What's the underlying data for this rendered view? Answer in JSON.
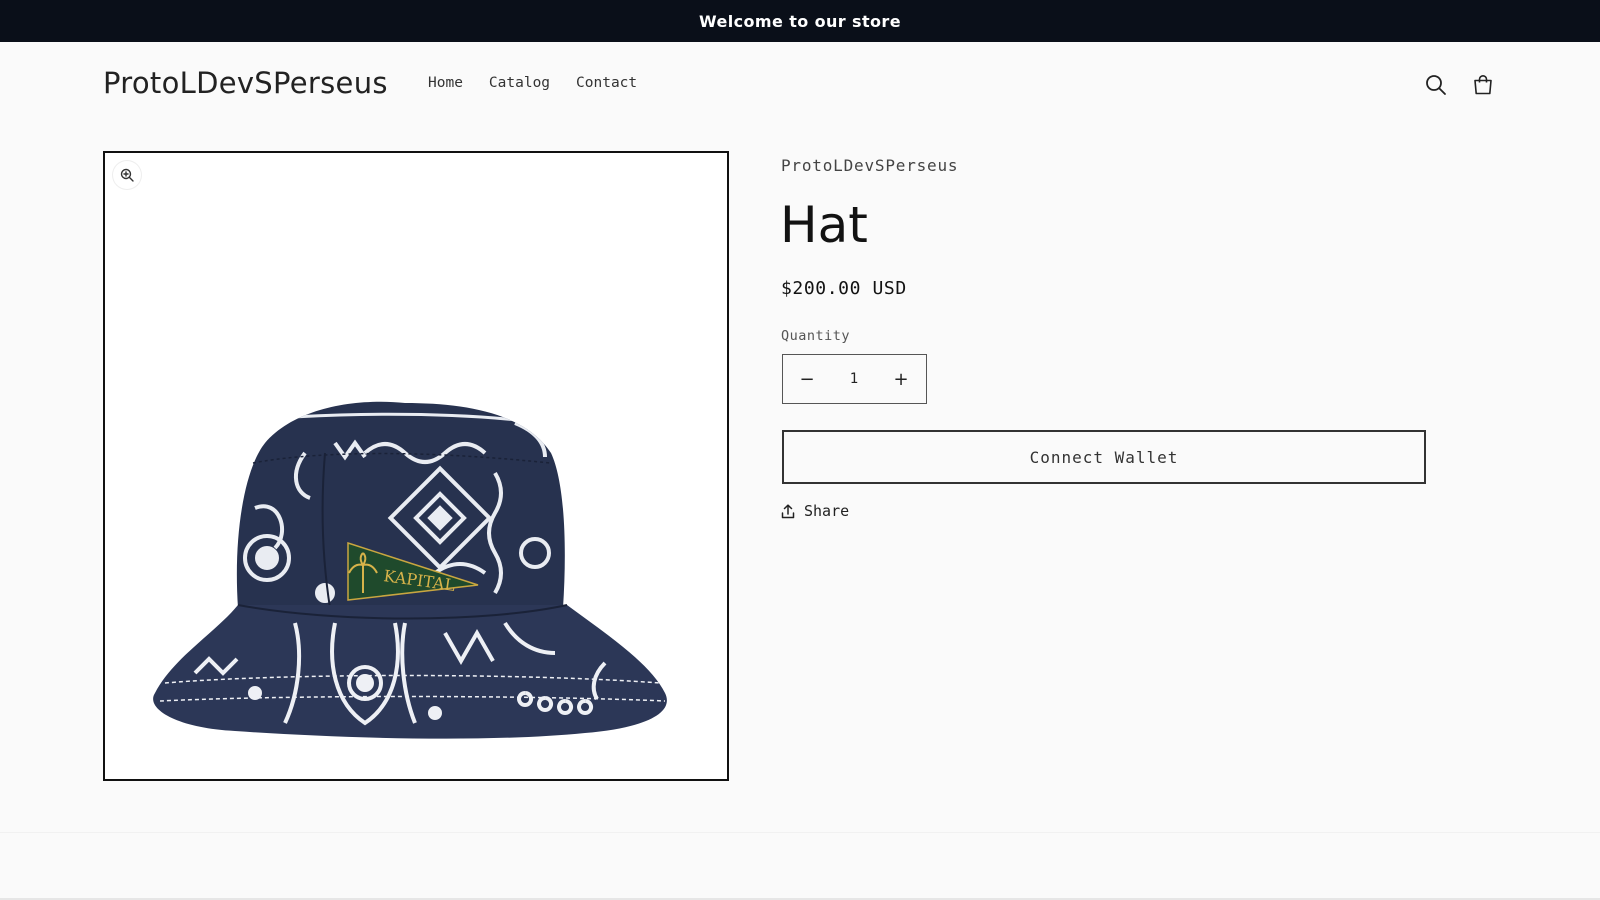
{
  "announcement": {
    "text": "Welcome to our store"
  },
  "header": {
    "logo": "ProtoLDevSPerseus",
    "nav": [
      {
        "label": "Home"
      },
      {
        "label": "Catalog"
      },
      {
        "label": "Contact"
      }
    ],
    "icons": {
      "search": "search-icon",
      "cart": "cart-icon"
    }
  },
  "product": {
    "vendor": "ProtoLDevSPerseus",
    "title": "Hat",
    "price": "$200.00 USD",
    "quantity_label": "Quantity",
    "quantity_value": "1",
    "decrement_label": "−",
    "increment_label": "+",
    "connect_label": "Connect Wallet",
    "share_label": "Share",
    "image": {
      "alt": "Kapital bandana patchwork bucket hat",
      "patch_text": "KAPITAL"
    }
  },
  "colors": {
    "announcement_bg": "#0a0f19",
    "page_bg": "#fafafa",
    "text": "#121212",
    "hat_navy": "#27324f"
  }
}
